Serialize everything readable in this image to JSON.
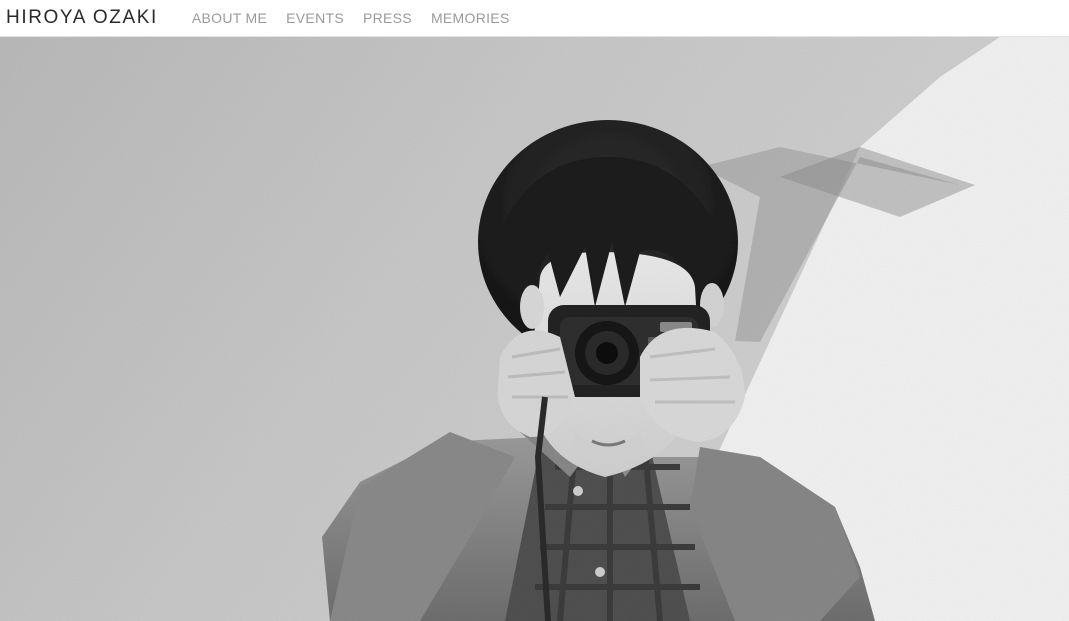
{
  "header": {
    "site_title": "HIROYA OZAKI",
    "nav": [
      {
        "label": "ABOUT ME"
      },
      {
        "label": "EVENTS"
      },
      {
        "label": "PRESS"
      },
      {
        "label": "MEMORIES"
      }
    ]
  },
  "hero": {
    "kind": "black-and-white photograph",
    "subject": "child holding a camera to the face"
  },
  "colors": {
    "title": "#2a2a2a",
    "nav": "#9a9a9a",
    "divider": "#e3e3e3"
  }
}
